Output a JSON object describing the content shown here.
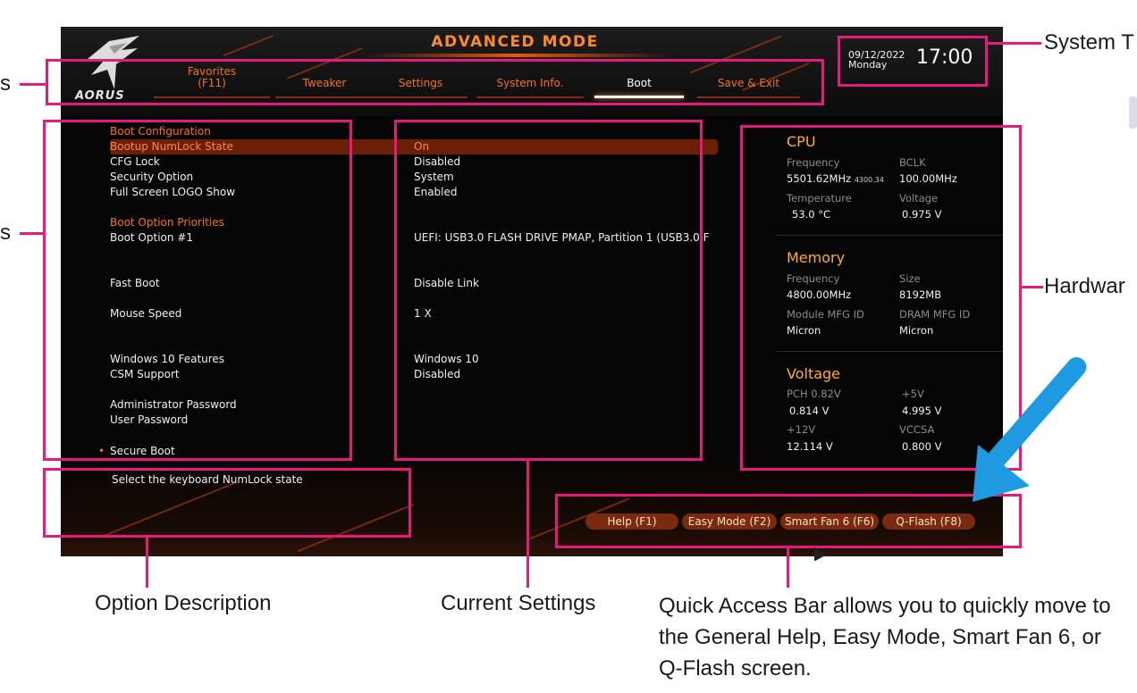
{
  "bios": {
    "mode_title": "ADVANCED MODE",
    "logo_text": "AORUS",
    "tabs": [
      {
        "label": "Favorites\n(F11)",
        "active": false
      },
      {
        "label": "Tweaker",
        "active": false
      },
      {
        "label": "Settings",
        "active": false
      },
      {
        "label": "System Info.",
        "active": false
      },
      {
        "label": "Boot",
        "active": true
      },
      {
        "label": "Save & Exit",
        "active": false
      }
    ],
    "clock": {
      "date": "09/12/2022",
      "day": "Monday",
      "time": "17:00"
    },
    "menu": [
      {
        "key": "Boot Configuration",
        "value": "",
        "type": "section"
      },
      {
        "key": "Bootup NumLock State",
        "value": "On",
        "type": "highlight"
      },
      {
        "key": "CFG Lock",
        "value": "Disabled",
        "type": "item"
      },
      {
        "key": "Security Option",
        "value": "System",
        "type": "item"
      },
      {
        "key": "Full Screen LOGO Show",
        "value": "Enabled",
        "type": "item"
      },
      {
        "key": "Boot Option Priorities",
        "value": "",
        "type": "section"
      },
      {
        "key": "Boot Option #1",
        "value": "UEFI: USB3.0 FLASH DRIVE PMAP, Partition 1 (USB3.0 F",
        "type": "item"
      },
      {
        "key": "Fast Boot",
        "value": "Disable Link",
        "type": "item"
      },
      {
        "key": "Mouse Speed",
        "value": "1 X",
        "type": "item"
      },
      {
        "key": "Windows 10 Features",
        "value": "Windows 10",
        "type": "item"
      },
      {
        "key": "CSM Support",
        "value": "Disabled",
        "type": "item"
      },
      {
        "key": "Administrator Password",
        "value": "",
        "type": "item"
      },
      {
        "key": "User Password",
        "value": "",
        "type": "item"
      },
      {
        "key": "Secure Boot",
        "value": "",
        "type": "submenu"
      }
    ],
    "description": "Select the keyboard NumLock state",
    "hardware": {
      "cpu": {
        "title": "CPU",
        "frequency_label": "Frequency",
        "frequency_value": "5501.62MHz",
        "frequency_sub": "4300.34",
        "bclk_label": "BCLK",
        "bclk_value": "100.00MHz",
        "temperature_label": "Temperature",
        "temperature_value": "53.0 °C",
        "voltage_label": "Voltage",
        "voltage_value": "0.975 V"
      },
      "memory": {
        "title": "Memory",
        "frequency_label": "Frequency",
        "frequency_value": "4800.00MHz",
        "size_label": "Size",
        "size_value": "8192MB",
        "module_mfg_label": "Module MFG ID",
        "module_mfg_value": "Micron",
        "dram_mfg_label": "DRAM MFG ID",
        "dram_mfg_value": "Micron"
      },
      "voltage": {
        "title": "Voltage",
        "pch_label": "PCH 0.82V",
        "pch_value": "0.814 V",
        "p5v_label": "+5V",
        "p5v_value": "4.995 V",
        "p12v_label": "+12V",
        "p12v_value": "12.114 V",
        "vccsa_label": "VCCSA",
        "vccsa_value": "0.800 V"
      }
    },
    "quick_access": [
      "Help (F1)",
      "Easy Mode (F2)",
      "Smart Fan 6 (F6)",
      "Q-Flash (F8)"
    ]
  },
  "annotations": {
    "system_time": "System T",
    "menus_left_1": "s",
    "menus_left_2": "s",
    "hardware": "Hardwar",
    "option_description": "Option Description",
    "current_settings": "Current Settings",
    "quick_access": "Quick Access Bar allows you to quickly move to the General Help, Easy Mode, Smart Fan 6, or Q-Flash screen."
  },
  "colors": {
    "annotation": "#e6197f",
    "accent": "#f97316",
    "highlight_row": "#6b1f07",
    "arrow": "#1e9be0"
  }
}
